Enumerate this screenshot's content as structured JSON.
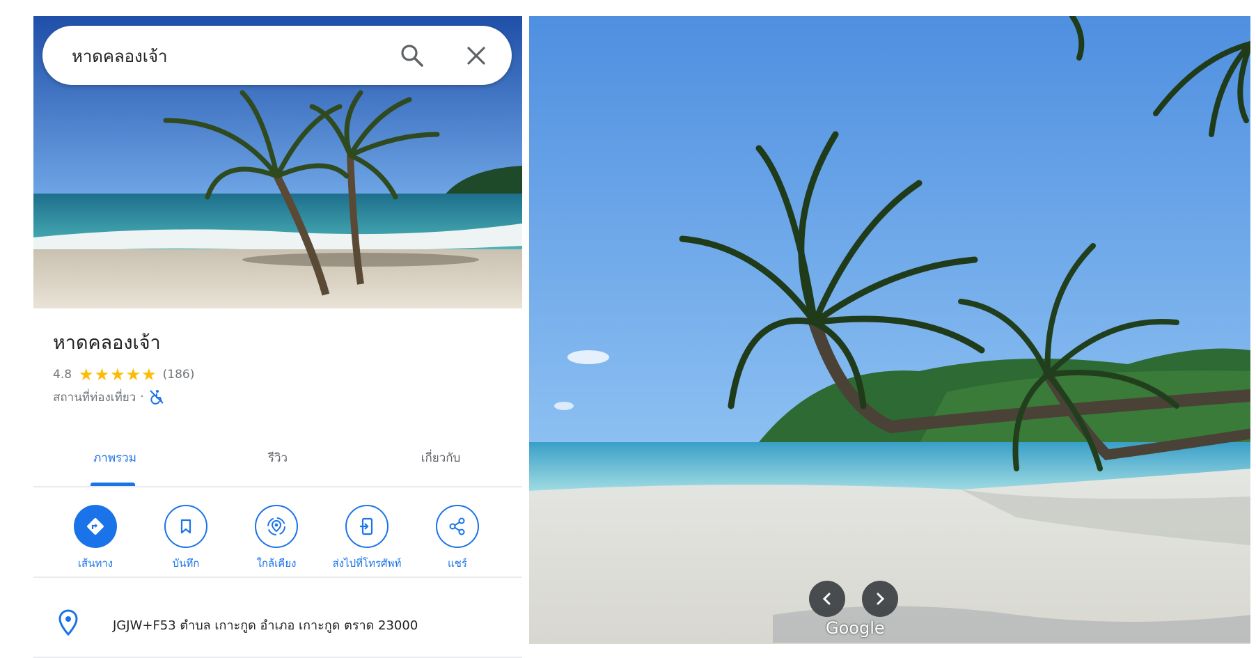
{
  "search": {
    "value": "หาดคลองเจ้า"
  },
  "place": {
    "title": "หาดคลองเจ้า",
    "rating": "4.8",
    "review_count": "(186)",
    "category": "สถานที่ท่องเที่ยว",
    "separator": "·",
    "star_rating": 4.8
  },
  "tabs": [
    {
      "label": "ภาพรวม",
      "active": true
    },
    {
      "label": "รีวิว",
      "active": false
    },
    {
      "label": "เกี่ยวกับ",
      "active": false
    }
  ],
  "actions": [
    {
      "label": "เส้นทาง",
      "icon": "directions-icon"
    },
    {
      "label": "บันทึก",
      "icon": "bookmark-icon"
    },
    {
      "label": "ใกล้เคียง",
      "icon": "nearby-icon"
    },
    {
      "label": "ส่งไปที่โทรศัพท์",
      "icon": "send-to-phone-icon"
    },
    {
      "label": "แชร์",
      "icon": "share-icon"
    }
  ],
  "address": {
    "text": "JGJW+F53 ตำบล เกาะกูด อำเภอ เกาะกูด ตราด 23000"
  },
  "photo": {
    "watermark": "Google"
  },
  "colors": {
    "accent": "#1a73e8",
    "star": "#fbbc04",
    "text": "#202124",
    "muted": "#70757a",
    "divider": "#e8eaed"
  }
}
